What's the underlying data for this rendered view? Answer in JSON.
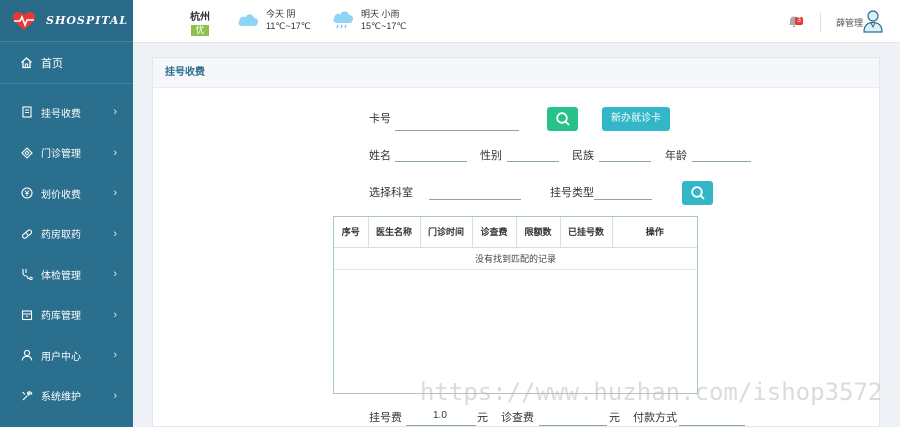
{
  "brand": {
    "name": "SHOSPITAL"
  },
  "sidebar": {
    "home": "首页",
    "items": [
      {
        "label": "挂号收费",
        "icon": "register-icon"
      },
      {
        "label": "门诊管理",
        "icon": "diamond-icon"
      },
      {
        "label": "划价收费",
        "icon": "yen-coin-icon"
      },
      {
        "label": "药房取药",
        "icon": "pill-icon"
      },
      {
        "label": "体检管理",
        "icon": "stethoscope-icon"
      },
      {
        "label": "药库管理",
        "icon": "storage-icon"
      },
      {
        "label": "用户中心",
        "icon": "user-icon"
      },
      {
        "label": "系统维护",
        "icon": "wrench-icon"
      }
    ]
  },
  "topbar": {
    "city": "杭州",
    "aqi": "优",
    "weather_today": {
      "line1": "今天 阴",
      "line2": "11℃~17℃"
    },
    "weather_tomorrow": {
      "line1": "明天 小雨",
      "line2": "15℃~17℃"
    },
    "notifications": "3",
    "username": "薛管理"
  },
  "panel": {
    "title": "挂号收费",
    "card_label": "卡号",
    "new_card_button": "新办就诊卡",
    "name_label": "姓名",
    "gender_label": "性别",
    "ethnicity_label": "民族",
    "age_label": "年龄",
    "department_label": "选择科室",
    "reg_type_label": "挂号类型",
    "table": {
      "headers": [
        "序号",
        "医生名称",
        "门诊时间",
        "诊查费",
        "限额数",
        "已挂号数",
        "操作"
      ],
      "empty_text": "没有找到匹配的记录"
    },
    "reg_fee_label": "挂号费",
    "reg_fee_value": "1.0",
    "yuan1": "元",
    "exam_fee_label": "诊查费",
    "yuan2": "元",
    "payment_label": "付款方式"
  },
  "watermark": "https://www.huzhan.com/ishop3572",
  "colors": {
    "sidebar": "#2b6f8f",
    "search_green": "#26c28a",
    "teal": "#33b6c8",
    "badge_red": "#e53935"
  }
}
